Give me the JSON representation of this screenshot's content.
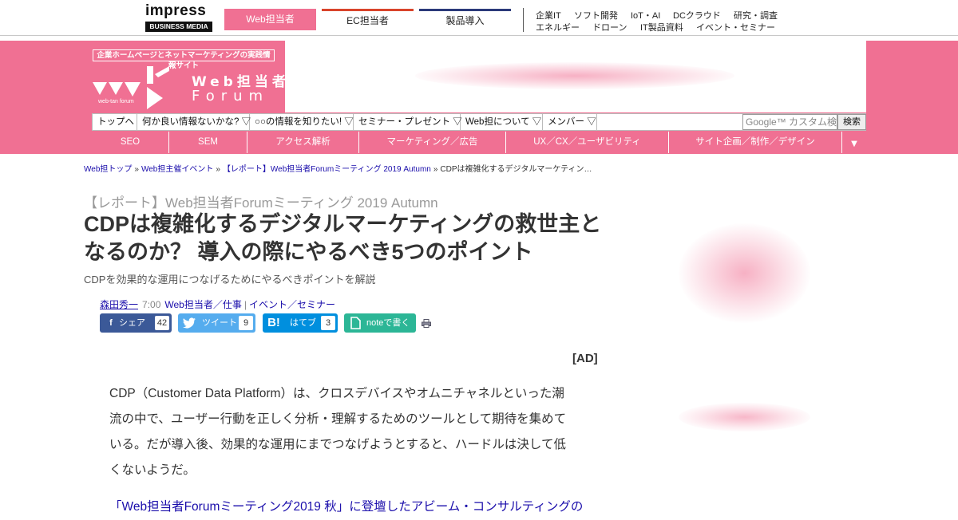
{
  "topbar": {
    "brand_line1": "impress",
    "brand_line2": "BUSINESS MEDIA",
    "tabs": [
      {
        "label": "Web担当者",
        "color": "#f07093"
      },
      {
        "label": "EC担当者",
        "color": "#d9442b"
      },
      {
        "label": "製品導入",
        "color": "#2b3a7a"
      }
    ],
    "links_row1": [
      "企業IT",
      "ソフト開発",
      "IoT・AI",
      "DCクラウド",
      "研究・調査"
    ],
    "links_row2": [
      "エネルギー",
      "ドローン",
      "IT製品資料",
      "イベント・セミナー"
    ]
  },
  "header": {
    "tagline": "企業ホームページとネットマーケティングの実践情報サイト",
    "site_name": "Web担当者",
    "site_name_en": "Forum",
    "site_sub": "web-tan forum",
    "brand_color": "#f07093"
  },
  "menu": {
    "items": [
      "トップへ",
      "何か良い情報ないかな? ▽",
      "○○の情報を知りたい! ▽",
      "セミナー・プレゼント ▽",
      "Web担について ▽",
      "メンバー ▽"
    ],
    "search_placeholder": "Google™ カスタム検索",
    "search_button": "検索"
  },
  "categories": {
    "items": [
      "SEO",
      "SEM",
      "アクセス解析",
      "マーケティング／広告",
      "UX／CX／ユーザビリティ",
      "サイト企画／制作／デザイン"
    ],
    "more": "▼"
  },
  "breadcrumb": {
    "items": [
      "Web担トップ",
      "Web担主催イベント",
      "【レポート】Web担当者Forumミーティング 2019 Autumn",
      "CDPは複雑化するデジタルマーケティン…"
    ],
    "separator": "»"
  },
  "article": {
    "series": "【レポート】Web担当者Forumミーティング 2019 Autumn",
    "title": "CDPは複雑化するデジタルマーケティングの救世主となるのか？ 導入の際にやるべき5つのポイント",
    "subtitle": "CDPを効果的な運用につなげるためにやるべきポイントを解説",
    "author": "森田秀一",
    "time": "7:00",
    "category1": "Web担当者／仕事",
    "category_sep": "|",
    "category2": "イベント／セミナー",
    "ad_label": "[AD]",
    "body": "CDP（Customer Data Platform）は、クロスデバイスやオムニチャネルといった潮流の中で、ユーザー行動を正しく分析・理解するためのツールとして期待を集めている。だが導入後、効果的な運用にまでつなげようとすると、ハードルは決して低くないようだ。",
    "body2": "「Web担当者Forumミーティング2019 秋」に登壇したアビーム・コンサルティングの"
  },
  "share": {
    "facebook": {
      "label": "シェア",
      "count": "42",
      "icon": "f"
    },
    "twitter": {
      "label": "ツイート",
      "count": "9",
      "icon": "bird"
    },
    "hatena": {
      "label": "はてブ",
      "count": "3",
      "icon": "B!"
    },
    "note": {
      "label": "noteで書く",
      "icon": "note"
    }
  }
}
